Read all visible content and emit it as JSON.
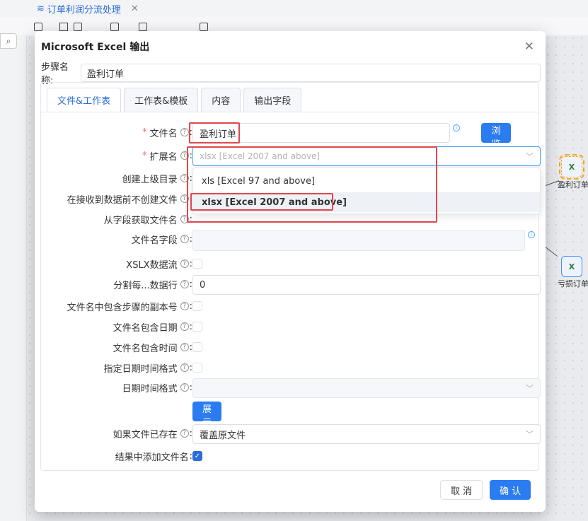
{
  "app": {
    "tab_label": "订单利润分流处理",
    "nodes": [
      {
        "label": "盈利订单"
      },
      {
        "label": "亏损订单"
      }
    ]
  },
  "dialog": {
    "title": "Microsoft Excel 输出",
    "step_name_label": "步骤名称:",
    "step_name_value": "盈利订单",
    "tabs": [
      {
        "label": "文件&工作表",
        "active": true
      },
      {
        "label": "工作表&模板",
        "active": false
      },
      {
        "label": "内容",
        "active": false
      },
      {
        "label": "输出字段",
        "active": false
      }
    ],
    "fields": {
      "filename_label": "文件名",
      "filename_value": "盈利订单",
      "browse_label": "浏 览",
      "extension_label": "扩展名",
      "extension_placeholder": "xlsx [Excel 2007 and above]",
      "create_parent_label": "创建上级目录",
      "no_create_label": "在接收到数据前不创建文件",
      "from_field_label": "从字段获取文件名",
      "filename_field_label": "文件名字段",
      "xslx_stream_label": "XSLX数据流",
      "split_label": "分割每...数据行",
      "split_value": "0",
      "include_copy_label": "文件名中包含步骤的副本号",
      "include_date_label": "文件名包含日期",
      "include_time_label": "文件名包含时间",
      "date_format_flag_label": "指定日期时间格式",
      "date_format_label": "日期时间格式",
      "show_filename_label": "展示文件名",
      "if_exists_label": "如果文件已存在",
      "if_exists_value": "覆盖原文件",
      "add_to_result_label": "结果中添加文件名"
    },
    "extension_options": [
      {
        "label": "xls [Excel 97 and above]",
        "selected": false
      },
      {
        "label": "xlsx [Excel 2007 and above]",
        "selected": true
      }
    ],
    "footer": {
      "cancel_label": "取 消",
      "ok_label": "确 认"
    },
    "accent_color": "#2b7cf0",
    "highlight_color": "#e0474c"
  }
}
